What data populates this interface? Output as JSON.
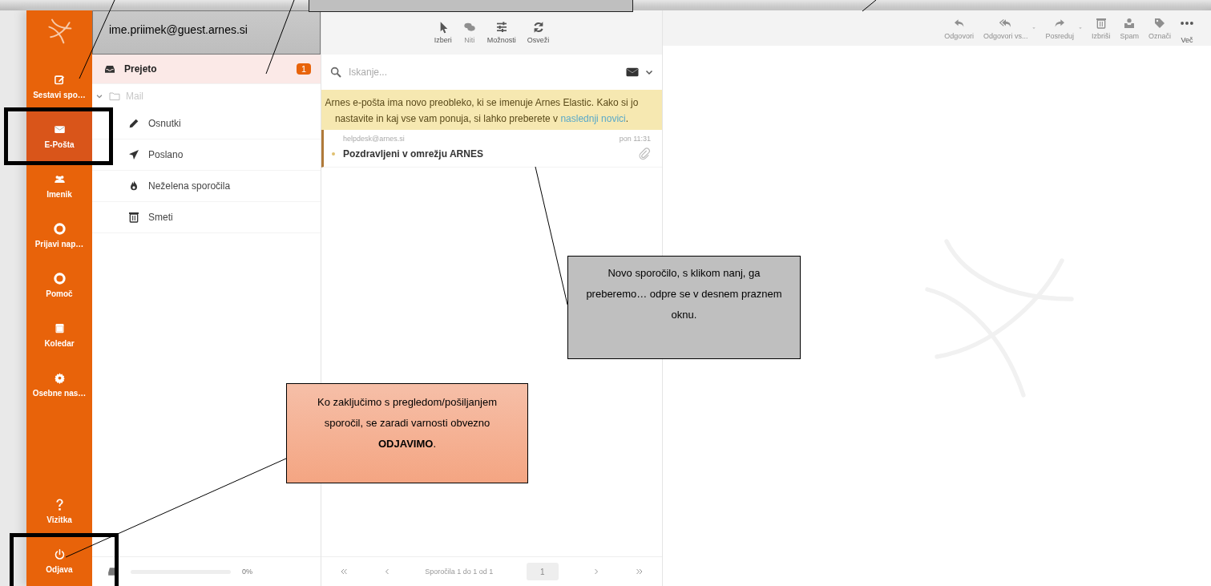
{
  "account": {
    "email": "ime.priimek@guest.arnes.si"
  },
  "sidebar": {
    "items": [
      {
        "label": "Sestavi spo…",
        "selected": false
      },
      {
        "label": "E-Pošta",
        "selected": true
      },
      {
        "label": "Imenik",
        "selected": false
      },
      {
        "label": "Prijavi nap…",
        "selected": false
      },
      {
        "label": "Pomoč",
        "selected": false
      },
      {
        "label": "Koledar",
        "selected": false
      },
      {
        "label": "Osebne nas…",
        "selected": false
      }
    ],
    "bottom_items": [
      {
        "label": "Vizitka",
        "selected": false
      },
      {
        "label": "Odjava",
        "selected": false
      }
    ]
  },
  "folders": [
    {
      "kind": "folder",
      "label": "Prejeto",
      "selected": true,
      "badge": "1"
    },
    {
      "kind": "group",
      "label": "Mail",
      "selected": false,
      "expanded": true,
      "children": [
        {
          "kind": "folder",
          "label": "Osnutki",
          "selected": false
        },
        {
          "kind": "folder",
          "label": "Poslano",
          "selected": false
        },
        {
          "kind": "folder",
          "label": "Neželena sporočila",
          "selected": false
        },
        {
          "kind": "folder",
          "label": "Smeti",
          "selected": false
        }
      ]
    }
  ],
  "quota": {
    "level": 0,
    "reading": "0%"
  },
  "list_toolbar": [
    {
      "label": "Izberi",
      "disabled": false
    },
    {
      "label": "Niti",
      "disabled": true
    },
    {
      "label": "Možnosti",
      "disabled": false
    },
    {
      "label": "Osveži",
      "disabled": false
    }
  ],
  "search": {
    "placeholder": "Iskanje..."
  },
  "notice": {
    "text": "Arnes e-pošta ima novo preobleko, ki se imenuje Arnes Elastic. Kako si jo nastavite in kaj vse vam ponuja, si lahko preberete v ",
    "link": "naslednji novici",
    "end": "."
  },
  "messages": [
    {
      "from": "helpdesk@arnes.si",
      "time": "pon 11:31",
      "subject": "Pozdravljeni v omrežju ARNES",
      "unread": true,
      "attachment": true,
      "selected": false
    }
  ],
  "pager": {
    "summary": "Sporočila 1 do 1 od 1",
    "page": "1"
  },
  "preview_toolbar": [
    {
      "label": "Odgovori",
      "disabled": true,
      "dropdown": false
    },
    {
      "label": "Odgovori vs...",
      "disabled": true,
      "dropdown": true
    },
    {
      "label": "Posreduj",
      "disabled": true,
      "dropdown": true
    },
    {
      "label": "Izbriši",
      "disabled": true,
      "dropdown": false
    },
    {
      "label": "Spam",
      "disabled": true,
      "dropdown": false
    },
    {
      "label": "Označi",
      "disabled": true,
      "dropdown": false
    },
    {
      "label": "Več",
      "disabled": false,
      "dropdown": false
    }
  ],
  "callouts": [
    {
      "kind": "note",
      "text": "Novo sporočilo, s klikom nanj, ga preberemo… odpre se v desnem praznem oknu."
    },
    {
      "kind": "warning",
      "text": "Ko zaključimo s pregledom/pošiljanjem sporočil, se zaradi varnosti obvezno **ODJAVIMO**."
    }
  ]
}
